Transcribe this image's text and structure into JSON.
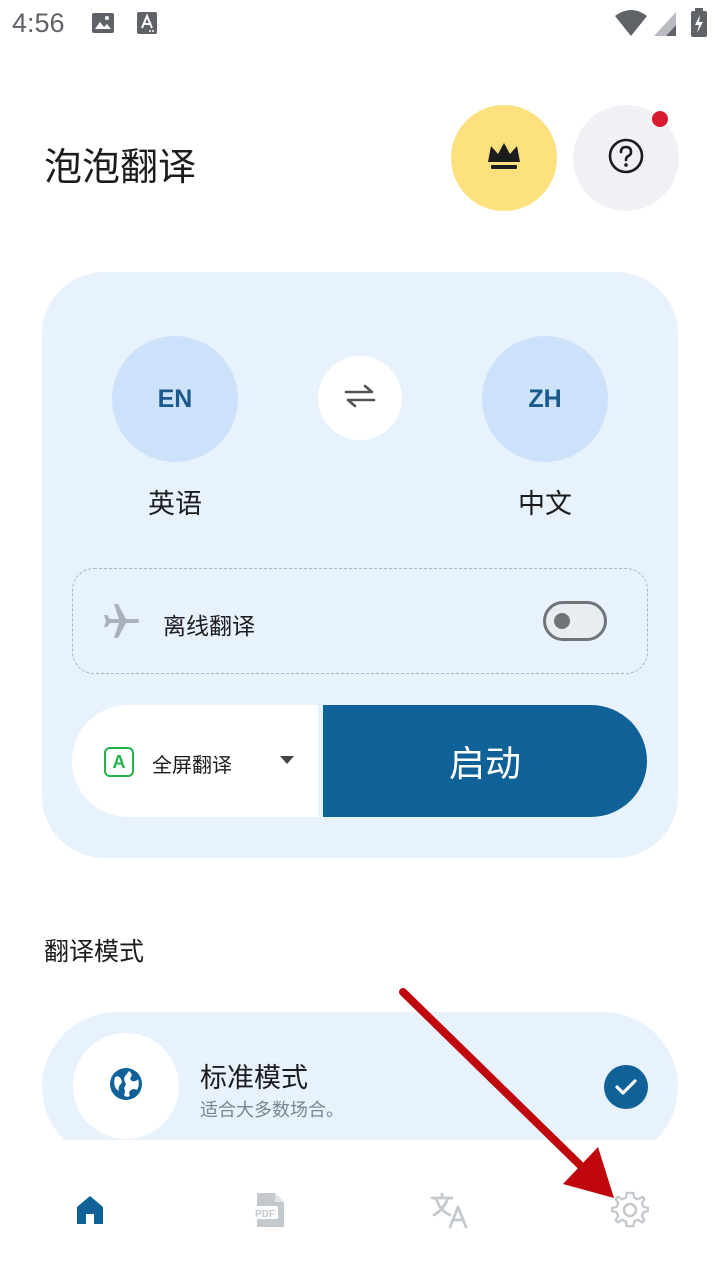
{
  "status_bar": {
    "time": "4:56"
  },
  "header": {
    "title": "泡泡翻译"
  },
  "languages": {
    "source": {
      "code": "EN",
      "name": "英语"
    },
    "target": {
      "code": "ZH",
      "name": "中文"
    }
  },
  "offline": {
    "label": "离线翻译",
    "enabled": false
  },
  "translate_mode_select": {
    "badge": "A",
    "label": "全屏翻译"
  },
  "start_button": {
    "label": "启动"
  },
  "modes_section": {
    "title": "翻译模式",
    "items": [
      {
        "title": "标准模式",
        "description": "适合大多数场合。",
        "selected": true
      }
    ]
  },
  "bottom_nav": {
    "items": [
      {
        "icon": "home-icon",
        "active": true
      },
      {
        "icon": "pdf-icon",
        "active": false
      },
      {
        "icon": "translate-icon",
        "active": false
      },
      {
        "icon": "settings-icon",
        "active": false
      }
    ]
  },
  "pdf_icon_text": "PDF",
  "colors": {
    "accent": "#0f6197",
    "card_bg": "#e8f2fd",
    "vip_bg": "#fde17e",
    "annotation_arrow": "#c0070d"
  }
}
